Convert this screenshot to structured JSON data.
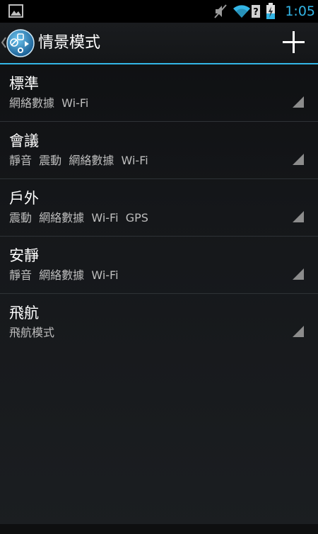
{
  "status_bar": {
    "time": "1:05",
    "accent_color": "#33b5e5",
    "icons": [
      "picture-notification-icon",
      "muted-speaker-icon",
      "wifi-icon",
      "signal-unknown-icon",
      "battery-charging-icon"
    ]
  },
  "action_bar": {
    "title": "情景模式",
    "add_icon": "plus-icon",
    "app_icon": "profiles-app-icon"
  },
  "profiles": [
    {
      "name": "標準",
      "summary": "網絡數據  Wi-Fi"
    },
    {
      "name": "會議",
      "summary": "靜音  震動  網絡數據  Wi-Fi"
    },
    {
      "name": "戶外",
      "summary": "震動  網絡數據  Wi-Fi  GPS"
    },
    {
      "name": "安靜",
      "summary": "靜音  網絡數據  Wi-Fi"
    },
    {
      "name": "飛航",
      "summary": "飛航模式"
    }
  ],
  "colors": {
    "holo_blue": "#33b5e5",
    "background": "#15171a",
    "divider": "#2e3236"
  }
}
